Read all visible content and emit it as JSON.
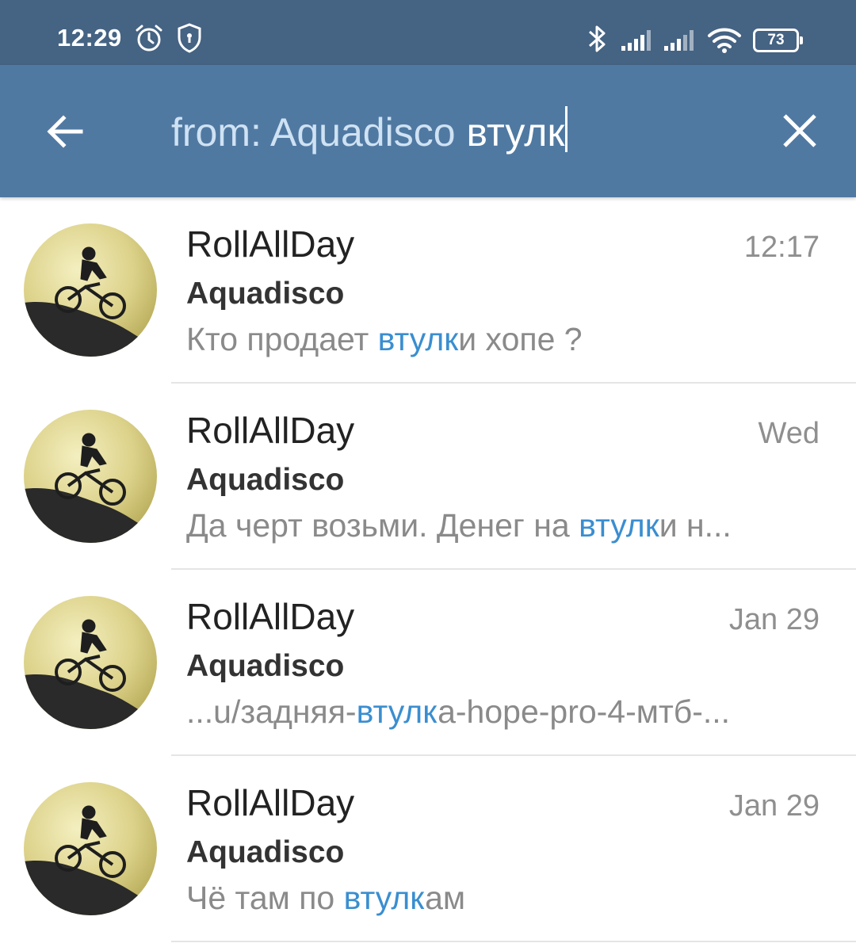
{
  "status_bar": {
    "time": "12:29",
    "battery": "73",
    "icons": [
      "alarm-icon",
      "shield-icon",
      "bluetooth-icon",
      "signal-icon",
      "signal-icon",
      "wifi-icon",
      "battery-icon"
    ]
  },
  "search": {
    "prefix": "from: Aquadisco",
    "query": "втулк",
    "back_icon": "arrow-left-icon",
    "clear_icon": "close-icon"
  },
  "colors": {
    "status_bar": "#456383",
    "header": "#5079a2",
    "highlight": "#3a8ed0"
  },
  "results": [
    {
      "chat": "RollAllDay",
      "date": "12:17",
      "sender": "Aquadisco",
      "snippet_before": "Кто продает ",
      "snippet_match": "втулк",
      "snippet_after": "и хопе ?"
    },
    {
      "chat": "RollAllDay",
      "date": "Wed",
      "sender": "Aquadisco",
      "snippet_before": "Да черт возьми. Денег на ",
      "snippet_match": "втулк",
      "snippet_after": "и н..."
    },
    {
      "chat": "RollAllDay",
      "date": "Jan 29",
      "sender": "Aquadisco",
      "snippet_before": "...u/задняя-",
      "snippet_match": "втулк",
      "snippet_after": "а-hope-pro-4-мтб-..."
    },
    {
      "chat": "RollAllDay",
      "date": "Jan 29",
      "sender": "Aquadisco",
      "snippet_before": "Чё там по ",
      "snippet_match": "втулк",
      "snippet_after": "ам"
    }
  ]
}
